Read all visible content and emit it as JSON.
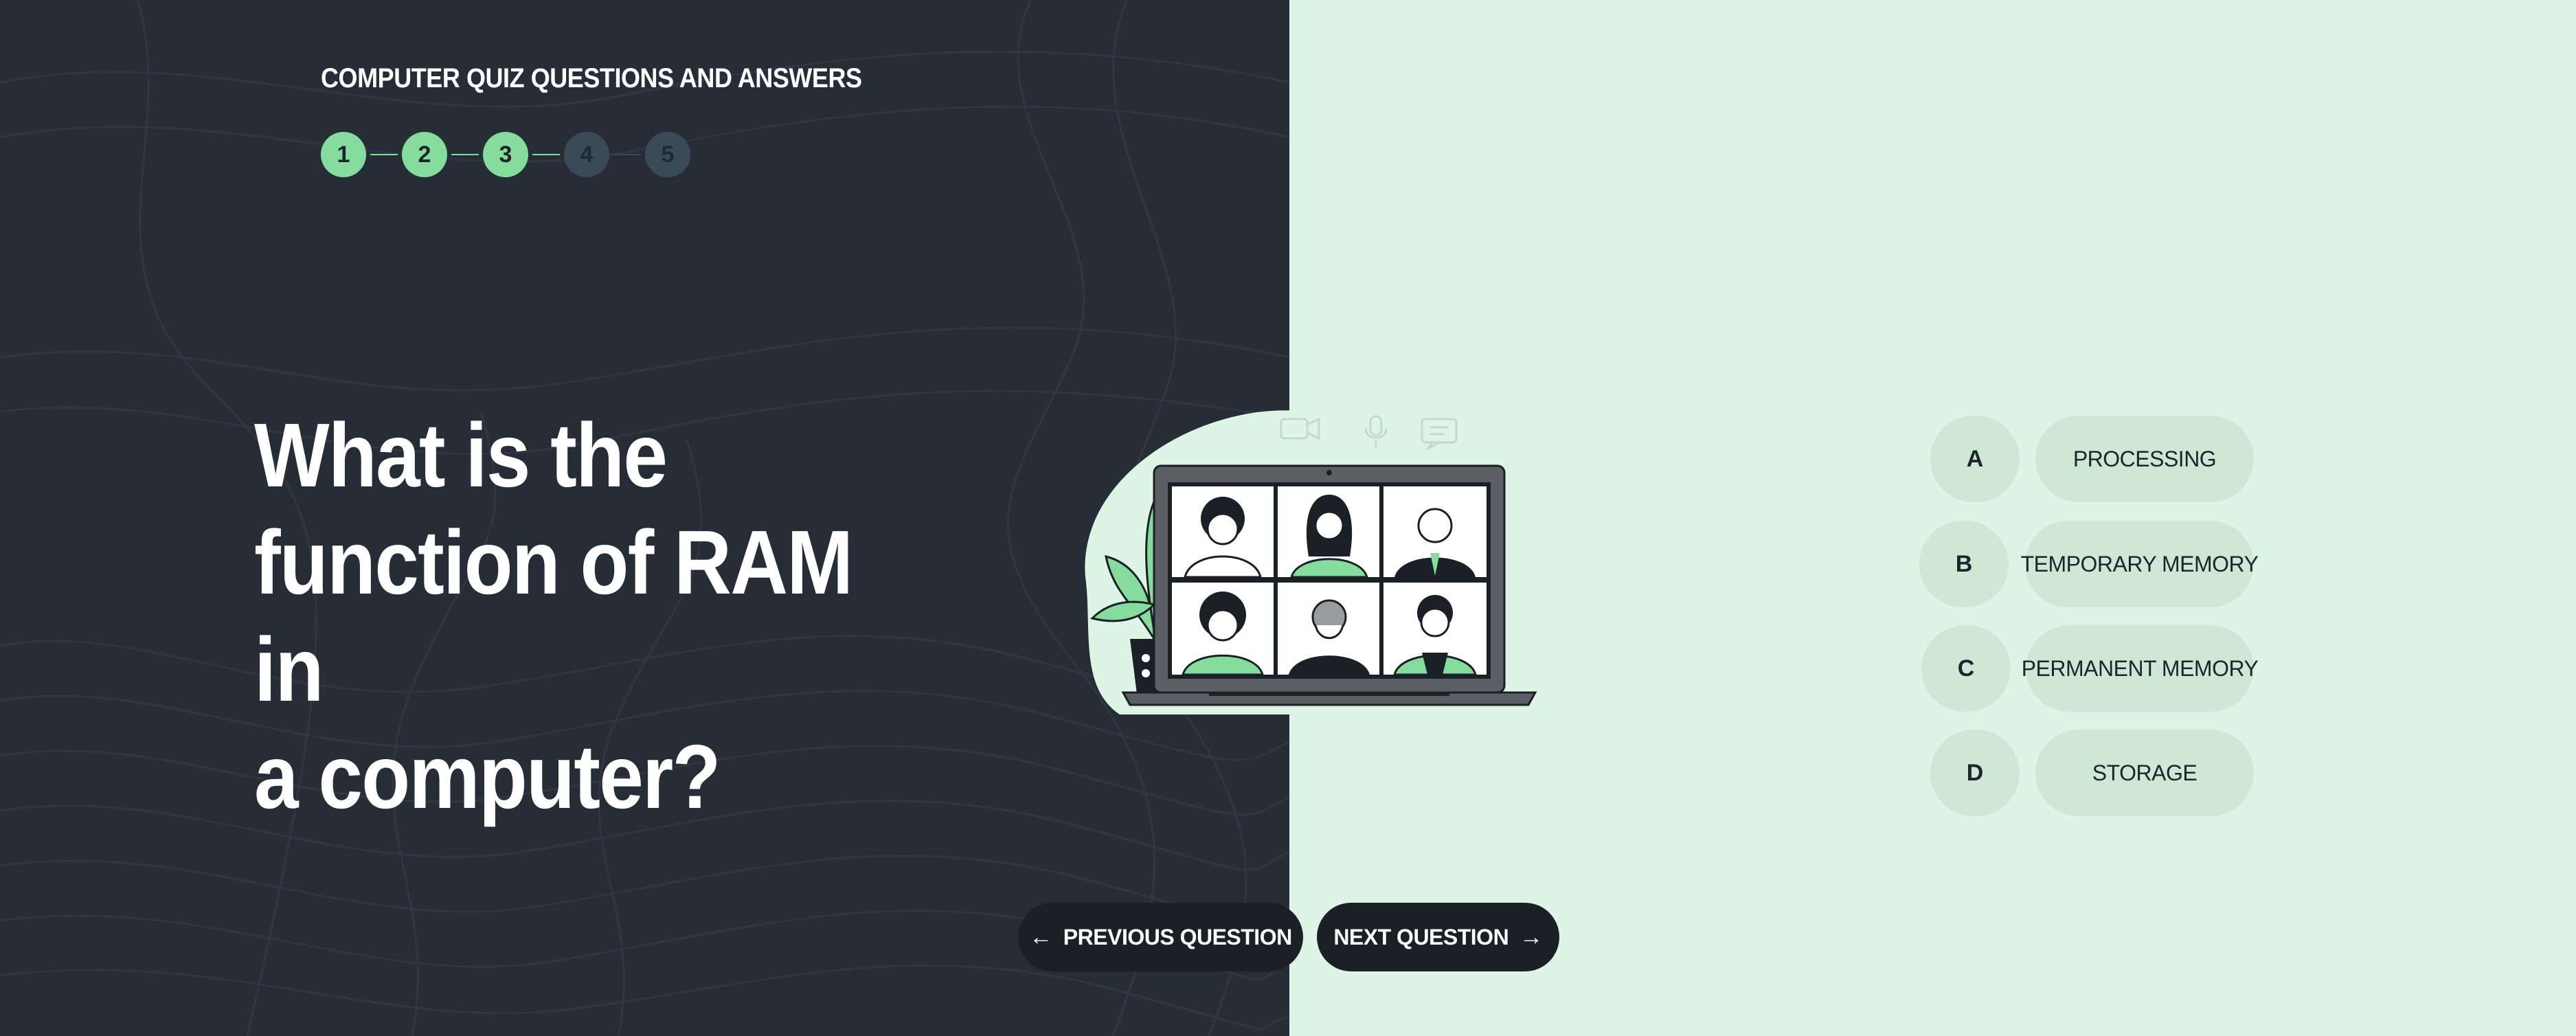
{
  "quiz": {
    "title": "COMPUTER QUIZ QUESTIONS AND ANSWERS"
  },
  "steps": [
    {
      "label": "1",
      "status": "completed"
    },
    {
      "label": "2",
      "status": "completed"
    },
    {
      "label": "3",
      "status": "current"
    },
    {
      "label": "4",
      "status": "upcoming"
    },
    {
      "label": "5",
      "status": "upcoming"
    }
  ],
  "question": {
    "line1": "What is the",
    "line2": "function of RAM in",
    "line3": "a computer?"
  },
  "answers": [
    {
      "letter": "A",
      "text": "PROCESSING"
    },
    {
      "letter": "B",
      "text": "TEMPORARY MEMORY"
    },
    {
      "letter": "C",
      "text": "PERMANENT MEMORY"
    },
    {
      "letter": "D",
      "text": "STORAGE"
    }
  ],
  "nav": {
    "previous_label": "PREVIOUS QUESTION",
    "next_label": "NEXT QUESTION",
    "previous_icon": "arrow-left-icon",
    "next_icon": "arrow-right-icon"
  },
  "colors": {
    "left_background": "#262d37",
    "right_background": "#dcf5e4",
    "accent_green": "#86dc9d",
    "inactive_step": "#3a4a56",
    "answer_pill": "#cfe8d6",
    "button_background": "#1b2027"
  }
}
